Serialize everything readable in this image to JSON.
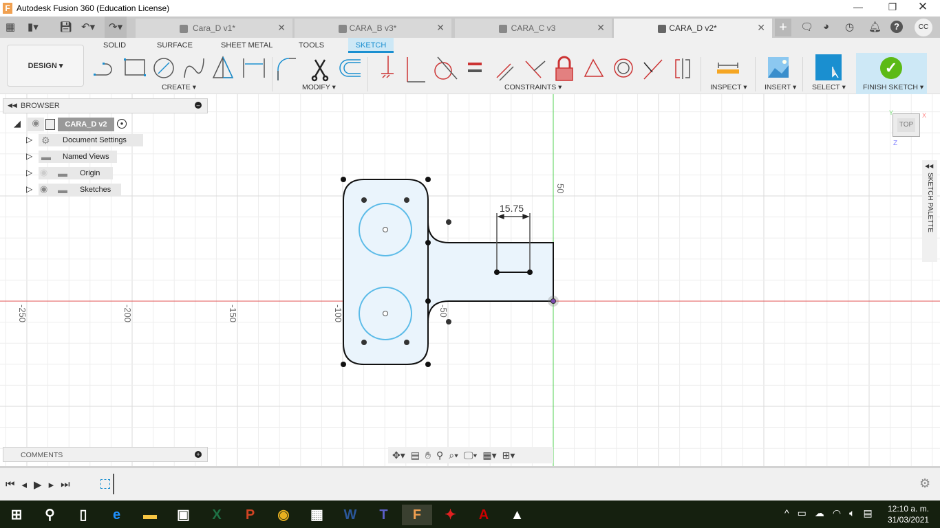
{
  "window": {
    "title": "Autodesk Fusion 360 (Education License)",
    "controls": [
      "minimize",
      "restore",
      "close"
    ]
  },
  "tabs": [
    {
      "label": "Cara_D v1*",
      "active": false
    },
    {
      "label": "CARA_B v3*",
      "active": false
    },
    {
      "label": "CARA_C v3",
      "active": false
    },
    {
      "label": "CARA_D v2*",
      "active": true
    }
  ],
  "user": {
    "initials": "CC"
  },
  "ribbon": {
    "workspace": "DESIGN",
    "tabs": [
      "SOLID",
      "SURFACE",
      "SHEET METAL",
      "TOOLS",
      "SKETCH"
    ],
    "active_tab": "SKETCH",
    "groups": {
      "create": "CREATE",
      "modify": "MODIFY",
      "constraints": "CONSTRAINTS",
      "inspect": "INSPECT",
      "insert": "INSERT",
      "select": "SELECT",
      "finish": "FINISH SKETCH"
    }
  },
  "browser": {
    "title": "BROWSER",
    "root": "CARA_D v2",
    "items": [
      {
        "label": "Document Settings",
        "icon": "gear-icon"
      },
      {
        "label": "Named Views",
        "icon": "folder-icon"
      },
      {
        "label": "Origin",
        "icon": "folder-icon",
        "visible": false
      },
      {
        "label": "Sketches",
        "icon": "folder-icon",
        "visible": true
      }
    ]
  },
  "comments": {
    "title": "COMMENTS"
  },
  "viewcube": {
    "face": "TOP",
    "axes": [
      "Y",
      "X",
      "Z"
    ]
  },
  "sketch_palette": {
    "label": "SKETCH PALETTE"
  },
  "canvas": {
    "axis_labels_x": [
      "-250",
      "-200",
      "-150",
      "-100",
      "-50"
    ],
    "axis_labels_y": [
      "50"
    ],
    "dimension": "15.75",
    "colors": {
      "x_axis": "#e05050",
      "y_axis": "#50d050",
      "profile_fill": "#eaf4fc",
      "circles": "#5bbbe8"
    }
  },
  "taskbar": {
    "apps": [
      "start",
      "search",
      "task-view",
      "edge",
      "file-explorer",
      "store",
      "excel",
      "powerpoint",
      "chrome",
      "calculator",
      "word",
      "teams",
      "fusion360",
      "app-red",
      "acrobat",
      "photos"
    ],
    "time": "12:10 a. m.",
    "date": "31/03/2021"
  }
}
